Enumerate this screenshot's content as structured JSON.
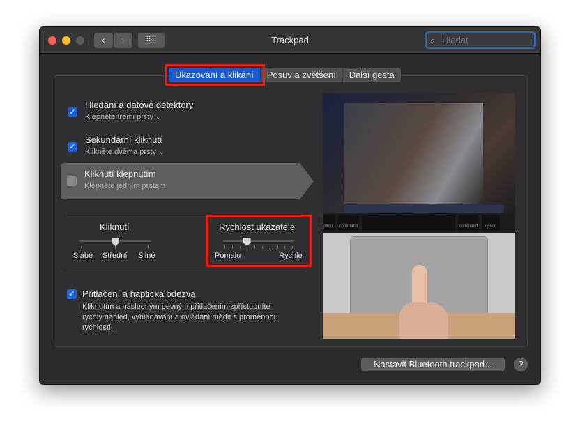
{
  "window": {
    "title": "Trackpad",
    "search_placeholder": "Hledat"
  },
  "tabs": [
    {
      "label": "Ukazování a klikání",
      "selected": true
    },
    {
      "label": "Posuv a zvětšení",
      "selected": false
    },
    {
      "label": "Další gesta",
      "selected": false
    }
  ],
  "options": [
    {
      "label": "Hledání a datové detektory",
      "sub": "Klepněte třemi prsty",
      "checked": true
    },
    {
      "label": "Sekundární kliknutí",
      "sub": "Klikněte dvěma prsty",
      "checked": true
    },
    {
      "label": "Kliknutí klepnutím",
      "sub": "Klepněte jedním prstem",
      "checked": false
    }
  ],
  "click_slider": {
    "title": "Kliknutí",
    "labels": [
      "Slabé",
      "Střední",
      "Silné"
    ],
    "value_index": 1
  },
  "speed_slider": {
    "title": "Rychlost ukazatele",
    "min_label": "Pomalu",
    "max_label": "Rychle",
    "value_fraction": 0.33
  },
  "force_click": {
    "label": "Přitlačení a haptická odezva",
    "checked": true,
    "description": "Kliknutím a následným pevným přitlačením zpřístupníte rychlý náhled, vyhledávání a ovládání médií s proměnnou rychlostí."
  },
  "preview": {
    "keys": [
      "option",
      "command",
      "command",
      "option"
    ]
  },
  "buttons": {
    "bluetooth": "Nastavit Bluetooth trackpad...",
    "help": "?"
  },
  "colors": {
    "accent": "#1b5ad1",
    "highlight": "#f41b0a"
  }
}
